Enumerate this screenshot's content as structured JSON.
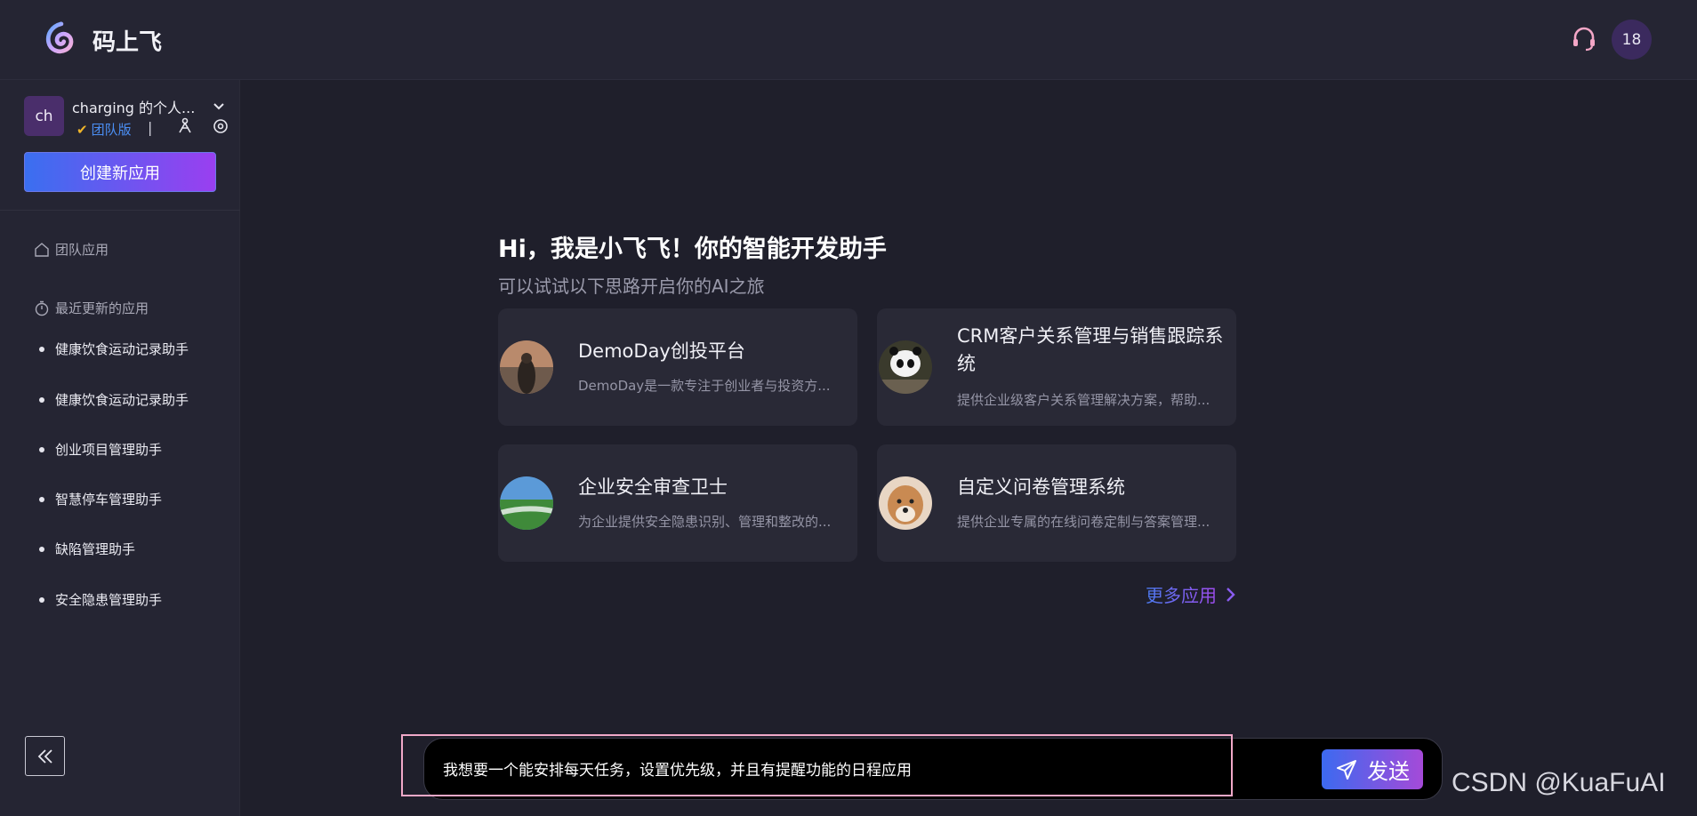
{
  "header": {
    "brand": "码上飞",
    "notifications": "18"
  },
  "sidebar": {
    "team_avatar": "ch",
    "team_name": "charging 的个人...",
    "team_badge": "团队版",
    "team_separator": "|",
    "create_button": "创建新应用",
    "sections": {
      "team_apps": "团队应用",
      "recent": "最近更新的应用"
    },
    "recent_items": [
      {
        "label": "健康饮食运动记录助手"
      },
      {
        "label": "健康饮食运动记录助手"
      },
      {
        "label": "创业项目管理助手"
      },
      {
        "label": "智慧停车管理助手"
      },
      {
        "label": "缺陷管理助手"
      },
      {
        "label": "安全隐患管理助手"
      }
    ]
  },
  "main": {
    "greeting": "Hi，我是小飞飞！你的智能开发助手",
    "subgreeting": "可以试试以下思路开启你的AI之旅",
    "cards": [
      {
        "title": "DemoDay创投平台",
        "desc": "DemoDay是一款专注于创业者与投资方..."
      },
      {
        "title": "CRM客户关系管理与销售跟踪系统",
        "desc": "提供企业级客户关系管理解决方案，帮助..."
      },
      {
        "title": "企业安全审查卫士",
        "desc": "为企业提供安全隐患识别、管理和整改的..."
      },
      {
        "title": "自定义问卷管理系统",
        "desc": "提供企业专属的在线问卷定制与答案管理..."
      }
    ],
    "more_link": "更多应用"
  },
  "input": {
    "value": "我想要一个能安排每天任务，设置优先级，并且有提醒功能的日程应用",
    "send_label": "发送"
  },
  "watermark": "CSDN @KuaFuAI",
  "icons": {
    "logo": "logo-icon",
    "support": "headset-icon",
    "chevron": "chevron-down-icon",
    "tool1": "share-icon",
    "tool2": "settings-icon",
    "home": "home-icon",
    "clock": "timer-icon",
    "collapse": "double-chevron-left-icon",
    "send": "paper-plane-icon",
    "more": "chevron-right-icon"
  },
  "colors": {
    "accent_start": "#3a6ff0",
    "accent_end": "#9a3ff0",
    "background": "#1f1f2b",
    "panel": "#252533"
  }
}
